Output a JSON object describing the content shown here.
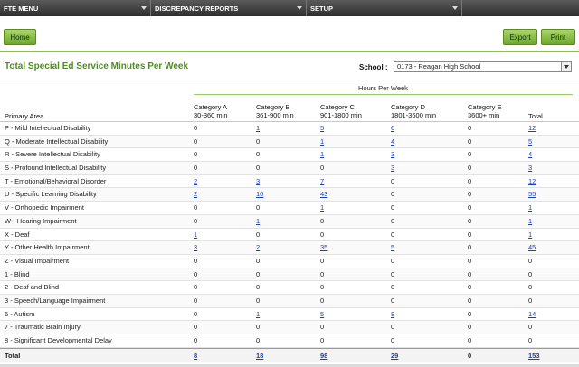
{
  "menu": [
    {
      "label": "FTE MENU"
    },
    {
      "label": "DISCREPANCY REPORTS"
    },
    {
      "label": "SETUP"
    }
  ],
  "toolbar": {
    "home_label": "Home",
    "export_label": "Export",
    "print_label": "Print"
  },
  "page": {
    "title": "Total Special Ed Service Minutes Per Week"
  },
  "school": {
    "label": "School :",
    "selected": "0173 - Reagan High School"
  },
  "table": {
    "group_header": "Hours Per Week",
    "primary_header": "Primary Area",
    "categories": [
      {
        "name": "Category A",
        "range": "30-360 min"
      },
      {
        "name": "Category B",
        "range": "361-900 min"
      },
      {
        "name": "Category C",
        "range": "901-1800 min"
      },
      {
        "name": "Category D",
        "range": "1801-3600 min"
      },
      {
        "name": "Category E",
        "range": "3600+ min"
      }
    ],
    "total_header": "Total",
    "rows": [
      {
        "area": "P - Mild Intellectual Disability",
        "vals": [
          "0",
          "1",
          "5",
          "6",
          "0",
          "12"
        ]
      },
      {
        "area": "Q - Moderate Intellectual Disability",
        "vals": [
          "0",
          "0",
          "1",
          "4",
          "0",
          "5"
        ]
      },
      {
        "area": "R - Severe Intellectual Disability",
        "vals": [
          "0",
          "0",
          "1",
          "3",
          "0",
          "4"
        ]
      },
      {
        "area": "S - Profound Intellectual Disability",
        "vals": [
          "0",
          "0",
          "0",
          "3",
          "0",
          "3"
        ]
      },
      {
        "area": "T - Emotional/Behavioral Disorder",
        "vals": [
          "2",
          "3",
          "7",
          "0",
          "0",
          "12"
        ]
      },
      {
        "area": "U - Specific Learning Disability",
        "vals": [
          "2",
          "10",
          "43",
          "0",
          "0",
          "55"
        ]
      },
      {
        "area": "V - Orthopedic Impairment",
        "vals": [
          "0",
          "0",
          "1",
          "0",
          "0",
          "1"
        ]
      },
      {
        "area": "W - Hearing Impairment",
        "vals": [
          "0",
          "1",
          "0",
          "0",
          "0",
          "1"
        ]
      },
      {
        "area": "X - Deaf",
        "vals": [
          "1",
          "0",
          "0",
          "0",
          "0",
          "1"
        ]
      },
      {
        "area": "Y - Other Health Impairment",
        "vals": [
          "3",
          "2",
          "35",
          "5",
          "0",
          "45"
        ]
      },
      {
        "area": "Z - Visual Impairment",
        "vals": [
          "0",
          "0",
          "0",
          "0",
          "0",
          "0"
        ]
      },
      {
        "area": "1 - Blind",
        "vals": [
          "0",
          "0",
          "0",
          "0",
          "0",
          "0"
        ]
      },
      {
        "area": "2 - Deaf and Blind",
        "vals": [
          "0",
          "0",
          "0",
          "0",
          "0",
          "0"
        ]
      },
      {
        "area": "3 - Speech/Language Impairment",
        "vals": [
          "0",
          "0",
          "0",
          "0",
          "0",
          "0"
        ]
      },
      {
        "area": "6 - Autism",
        "vals": [
          "0",
          "1",
          "5",
          "8",
          "0",
          "14"
        ]
      },
      {
        "area": "7 - Traumatic Brain Injury",
        "vals": [
          "0",
          "0",
          "0",
          "0",
          "0",
          "0"
        ]
      },
      {
        "area": "8 - Significant Developmental Delay",
        "vals": [
          "0",
          "0",
          "0",
          "0",
          "0",
          "0"
        ]
      }
    ],
    "total": {
      "label": "Total",
      "vals": [
        "8",
        "18",
        "98",
        "29",
        "0",
        "153"
      ]
    }
  },
  "colors": {
    "accent_green": "#4d8e1e",
    "link_blue": "#1a3fb8",
    "menubar": "#3a3a3a"
  }
}
